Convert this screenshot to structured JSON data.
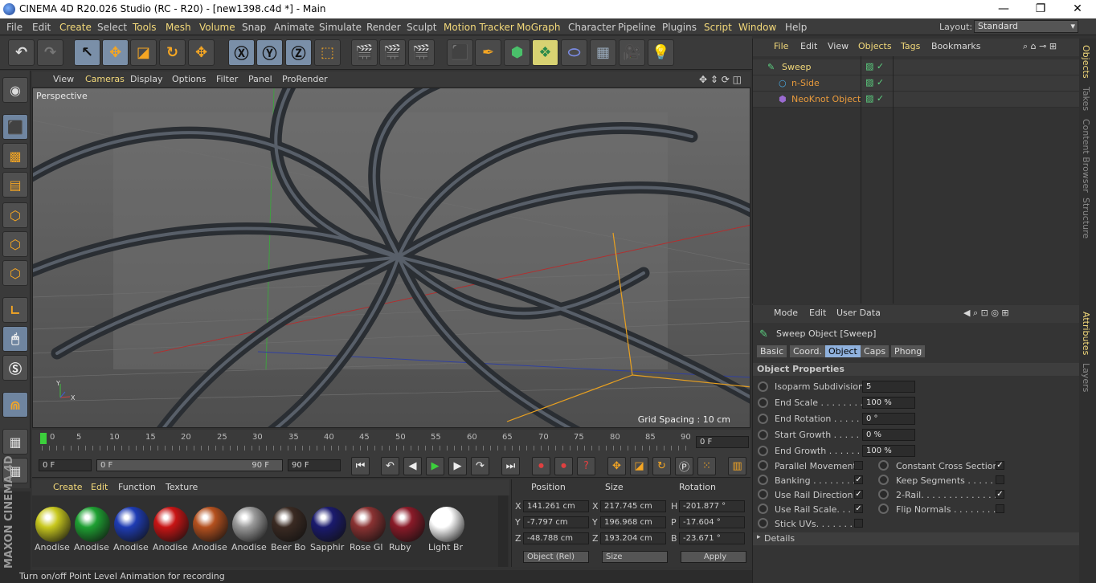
{
  "window": {
    "title": "CINEMA 4D R20.026 Studio (RC - R20) - [new1398.c4d *] - Main",
    "minimize": "—",
    "maximize": "❐",
    "close": "✕"
  },
  "menu": [
    "File",
    "Edit",
    "Create",
    "Select",
    "Tools",
    "Mesh",
    "Volume",
    "Snap",
    "Animate",
    "Simulate",
    "Render",
    "Sculpt",
    "Motion Tracker",
    "MoGraph",
    "Character",
    "Pipeline",
    "Plugins",
    "Script",
    "Window",
    "Help"
  ],
  "layout": {
    "label": "Layout:",
    "value": "Standard"
  },
  "viewport": {
    "menu": [
      "View",
      "Cameras",
      "Display",
      "Options",
      "Filter",
      "Panel",
      "ProRender"
    ],
    "label": "Perspective",
    "grid_spacing": "Grid Spacing : 10 cm"
  },
  "timeline": {
    "ticks": [
      "0",
      "5",
      "10",
      "15",
      "20",
      "25",
      "30",
      "35",
      "40",
      "45",
      "50",
      "55",
      "60",
      "65",
      "70",
      "75",
      "80",
      "85",
      "90"
    ],
    "current": "0 F"
  },
  "playback": {
    "start": "0 F",
    "range_start": "0 F",
    "range_end": "90 F",
    "end": "90 F"
  },
  "materials": {
    "menu": [
      "Create",
      "Edit",
      "Function",
      "Texture"
    ],
    "items": [
      {
        "name": "Anodise",
        "color": "#c8c81e"
      },
      {
        "name": "Anodise",
        "color": "#1ea032"
      },
      {
        "name": "Anodise",
        "color": "#1e3cb4"
      },
      {
        "name": "Anodise",
        "color": "#c81414"
      },
      {
        "name": "Anodise",
        "color": "#b4501e"
      },
      {
        "name": "Anodise",
        "color": "#9a9a9a"
      },
      {
        "name": "Beer Bo",
        "color": "#3a2a22"
      },
      {
        "name": "Sapphir",
        "color": "#1a1a6e"
      },
      {
        "name": "Rose Gl",
        "color": "#8a3232"
      },
      {
        "name": "Ruby",
        "color": "#8a1a28"
      },
      {
        "name": "Light Br",
        "color": "#ffffff"
      }
    ]
  },
  "coordinates": {
    "headers": [
      "Position",
      "Size",
      "Rotation"
    ],
    "rows": [
      {
        "axis": "X",
        "pos": "141.261 cm",
        "size_axis": "X",
        "size": "217.745 cm",
        "rot_axis": "H",
        "rot": "-201.877 °"
      },
      {
        "axis": "Y",
        "pos": "-7.797 cm",
        "size_axis": "Y",
        "size": "196.968 cm",
        "rot_axis": "P",
        "rot": "-17.604 °"
      },
      {
        "axis": "Z",
        "pos": "-48.788 cm",
        "size_axis": "Z",
        "size": "193.204 cm",
        "rot_axis": "B",
        "rot": "-23.671 °"
      }
    ],
    "mode": "Object (Rel)",
    "size_mode": "Size",
    "apply": "Apply"
  },
  "status": "Turn on/off Point Level Animation for recording",
  "object_manager": {
    "menu": [
      "File",
      "Edit",
      "View",
      "Objects",
      "Tags",
      "Bookmarks"
    ],
    "objects": [
      {
        "name": "Sweep",
        "color": "#f3d97a"
      },
      {
        "name": "n-Side",
        "color": "#e89a3c"
      },
      {
        "name": "NeoKnot Object",
        "color": "#e89a3c"
      }
    ]
  },
  "side_tabs_top": [
    "Objects",
    "Takes",
    "Content Browser",
    "Structure"
  ],
  "side_tabs_bottom": [
    "Attributes",
    "Layers"
  ],
  "attributes": {
    "menu": [
      "Mode",
      "Edit",
      "User Data"
    ],
    "title": "Sweep Object [Sweep]",
    "tabs": [
      "Basic",
      "Coord.",
      "Object",
      "Caps",
      "Phong"
    ],
    "section": "Object Properties",
    "props": [
      {
        "label": "Isoparm Subdivision",
        "value": "5"
      },
      {
        "label": "End Scale . . . . . . . . .",
        "value": "100 %"
      },
      {
        "label": "End Rotation . . . . . .",
        "value": "0 °"
      },
      {
        "label": "Start Growth . . . . . .",
        "value": "0 %"
      },
      {
        "label": "End Growth . . . . . . .",
        "value": "100 %"
      }
    ],
    "checks_left": [
      {
        "label": "Parallel Movement",
        "checked": ""
      },
      {
        "label": "Banking . . . . . . . . .",
        "checked": "✓"
      },
      {
        "label": "Use Rail Direction",
        "checked": "✓"
      },
      {
        "label": "Use Rail Scale. . . .",
        "checked": "✓"
      },
      {
        "label": "Stick UVs. . . . . . . .",
        "checked": ""
      }
    ],
    "checks_right": [
      {
        "label": "Constant Cross Section",
        "checked": "✓"
      },
      {
        "label": "Keep Segments . . . . . .",
        "checked": ""
      },
      {
        "label": "2-Rail. . . . . . . . . . . . . .",
        "checked": "✓"
      },
      {
        "label": "Flip Normals . . . . . . . . .",
        "checked": ""
      }
    ],
    "details": "Details"
  }
}
